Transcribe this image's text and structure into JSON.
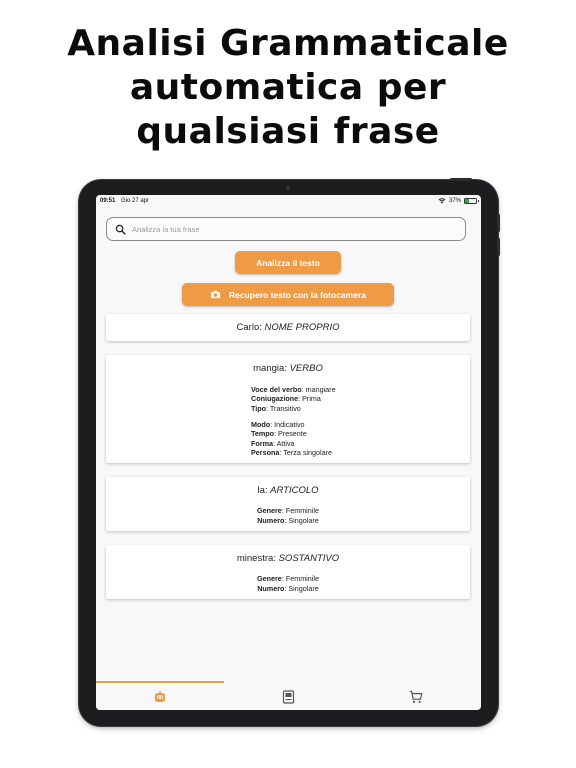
{
  "promo": {
    "title_line1": "Analisi Grammaticale",
    "title_line2": "automatica per",
    "title_line3": "qualsiasi frase"
  },
  "status_bar": {
    "time": "09:51",
    "date": "Gio 27 apr",
    "battery_text": "37%",
    "battery_level": 0.37
  },
  "search": {
    "placeholder": "Analizza la tua frase"
  },
  "buttons": {
    "analyze_label": "Analizza il testo",
    "camera_label": "Recupero testo con la fotocamera"
  },
  "results": [
    {
      "word": "Carlo",
      "category": "NOME PROPRIO"
    },
    {
      "word": "mangia",
      "category": "VERBO",
      "group1": [
        {
          "key": "Voce del verbo",
          "value": "mangiare"
        },
        {
          "key": "Coniugazione",
          "value": "Prima"
        },
        {
          "key": "Tipo",
          "value": "Transitivo"
        }
      ],
      "group2": [
        {
          "key": "Modo",
          "value": "Indicativo"
        },
        {
          "key": "Tempo",
          "value": "Presente"
        },
        {
          "key": "Forma",
          "value": "Attiva"
        },
        {
          "key": "Persona",
          "value": "Terza singolare"
        }
      ]
    },
    {
      "word": "la",
      "category": "ARTICOLO",
      "group1": [
        {
          "key": "Genere",
          "value": "Femminile"
        },
        {
          "key": "Numero",
          "value": "Singolare"
        }
      ]
    },
    {
      "word": "minestra",
      "category": "SOSTANTIVO",
      "group1": [
        {
          "key": "Genere",
          "value": "Femminile"
        },
        {
          "key": "Numero",
          "value": "Singolare"
        }
      ]
    }
  ],
  "tabs": [
    {
      "icon": "robot-icon",
      "active": true
    },
    {
      "icon": "book-icon",
      "active": false
    },
    {
      "icon": "cart-icon",
      "active": false
    }
  ],
  "colors": {
    "accent": "#ef9a45",
    "screen_bg": "#f8f8f8",
    "device_frame": "#1d1d1f"
  }
}
